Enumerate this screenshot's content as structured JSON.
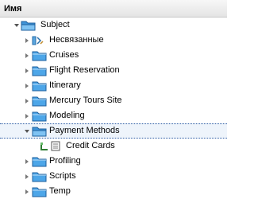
{
  "header": {
    "column_label": "Имя"
  },
  "tree": {
    "root": {
      "label": "Subject",
      "expanded": true,
      "icon": "folder-open-icon"
    },
    "items": [
      {
        "label": "Несвязанные",
        "icon": "unattached-icon",
        "expanded": false
      },
      {
        "label": "Cruises",
        "icon": "folder-icon",
        "expanded": false
      },
      {
        "label": "Flight Reservation",
        "icon": "folder-icon",
        "expanded": false
      },
      {
        "label": "Itinerary",
        "icon": "folder-icon",
        "expanded": false
      },
      {
        "label": "Mercury Tours Site",
        "icon": "folder-icon",
        "expanded": false
      },
      {
        "label": "Modeling",
        "icon": "folder-icon",
        "expanded": false
      },
      {
        "label": "Payment Methods",
        "icon": "folder-open-icon",
        "expanded": true,
        "selected": true,
        "children": [
          {
            "label": "Credit Cards",
            "icon": "requirement-icon"
          }
        ]
      },
      {
        "label": "Profiling",
        "icon": "folder-icon",
        "expanded": false
      },
      {
        "label": "Scripts",
        "icon": "folder-icon",
        "expanded": false
      },
      {
        "label": "Temp",
        "icon": "folder-icon",
        "expanded": false
      }
    ]
  },
  "colors": {
    "folder": "#4da6e8",
    "selection_background": "#eef4fb",
    "selection_border": "#2b5aa3"
  }
}
